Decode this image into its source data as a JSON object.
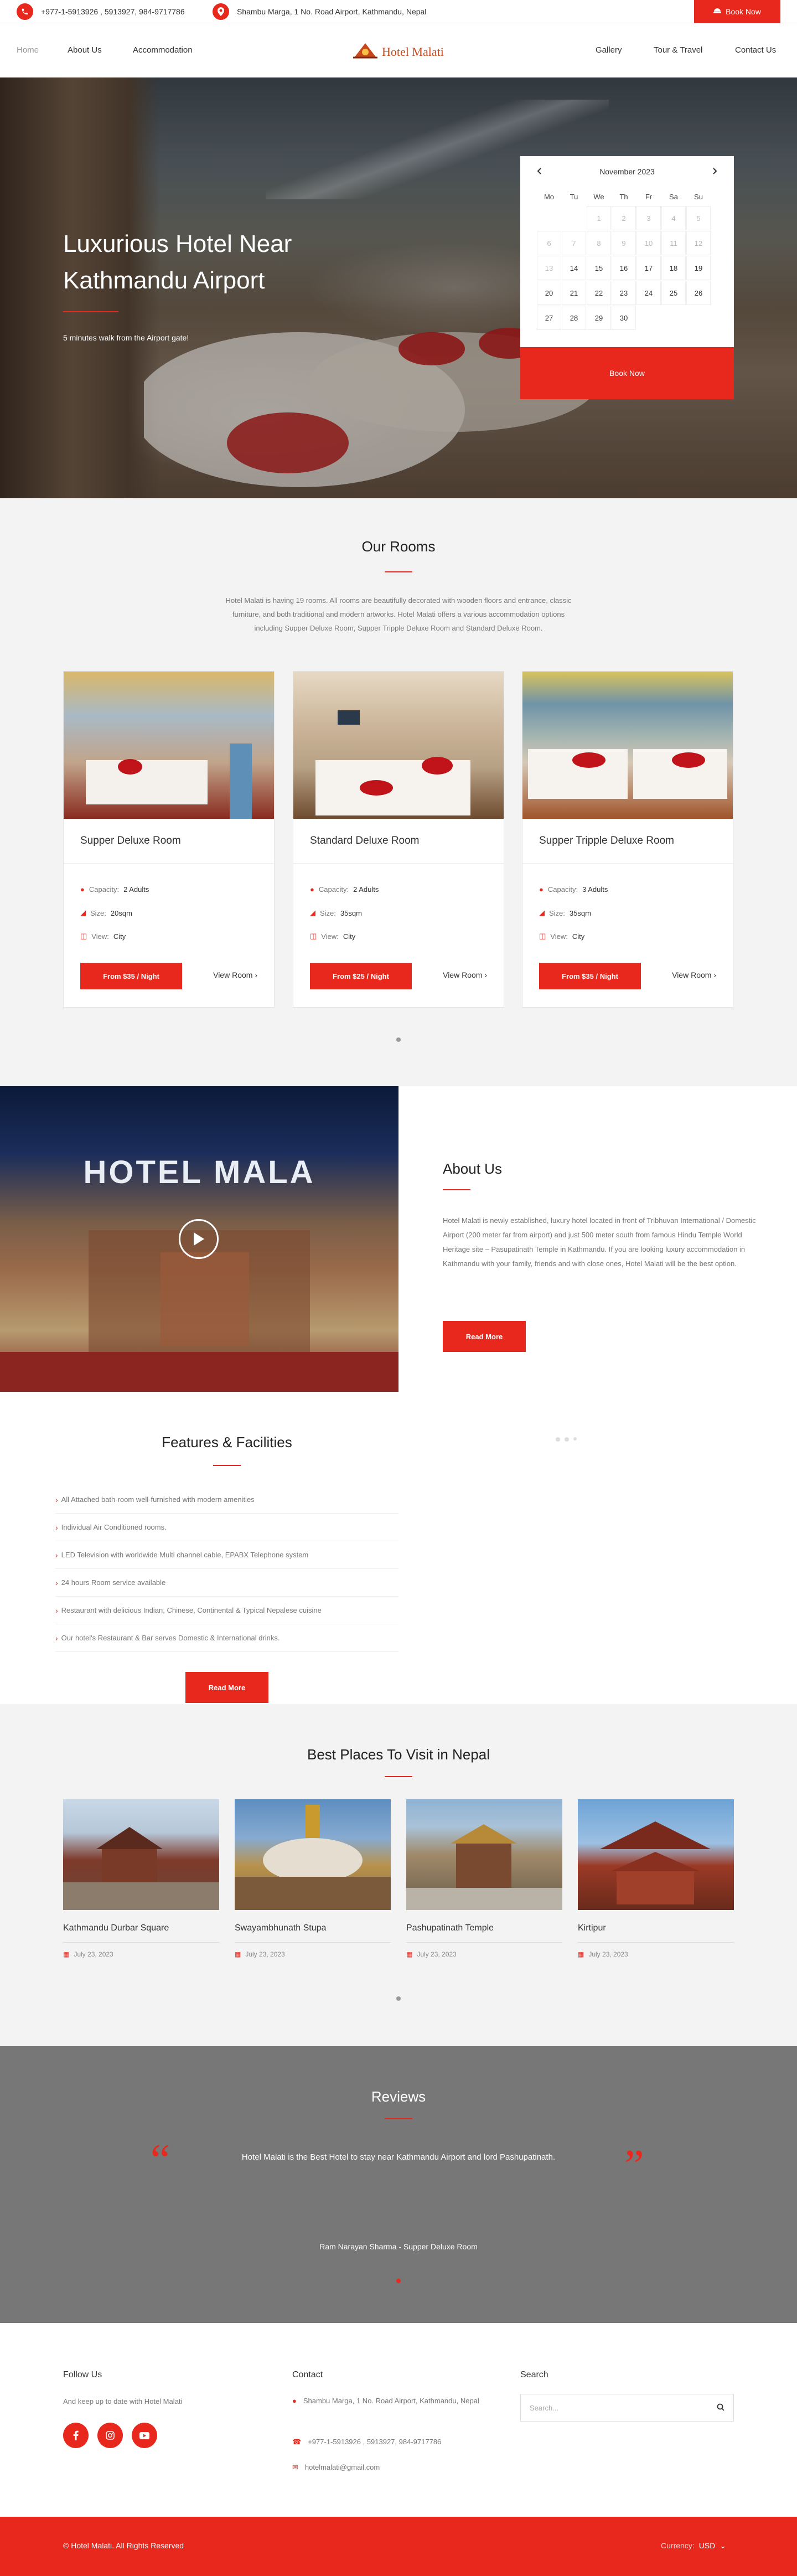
{
  "topbar": {
    "phone": "+977-1-5913926 , 5913927, 984-9717786",
    "address": "Shambu Marga, 1 No. Road Airport, Kathmandu, Nepal",
    "book_now": "Book Now"
  },
  "nav": {
    "left": [
      "Home",
      "About Us",
      "Accommodation"
    ],
    "logo": "Hotel Malati",
    "right": [
      "Gallery",
      "Tour & Travel",
      "Contact Us"
    ]
  },
  "hero": {
    "title": "Luxurious Hotel Near Kathmandu Airport",
    "subtitle": "5 minutes walk from the Airport gate!"
  },
  "calendar": {
    "month": "November 2023",
    "days_of_week": [
      "Mo",
      "Tu",
      "We",
      "Th",
      "Fr",
      "Sa",
      "Su"
    ],
    "book_now": "Book Now"
  },
  "rooms": {
    "title": "Our Rooms",
    "description": "Hotel Malati  is having 19 rooms. All rooms are beautifully decorated with wooden floors and entrance, classic furniture, and both traditional and modern artworks. Hotel Malati offers a various accommodation options including Supper Deluxe Room, Supper Tripple Deluxe Room and Standard Deluxe Room.",
    "capacity_label": "Capacity:",
    "size_label": "Size:",
    "view_label": "View:",
    "view_room": "View Room",
    "items": [
      {
        "name": "Supper Deluxe Room",
        "capacity": "2 Adults",
        "size": "20sqm",
        "view": "City",
        "price": "From $35 / Night"
      },
      {
        "name": "Standard Deluxe Room",
        "capacity": "2 Adults",
        "size": "35sqm",
        "view": "City",
        "price": "From $25 / Night"
      },
      {
        "name": "Supper Tripple Deluxe Room",
        "capacity": "3 Adults",
        "size": "35sqm",
        "view": "City",
        "price": "From $35 / Night"
      }
    ]
  },
  "about": {
    "sign": "HOTEL MALA",
    "title": "About Us",
    "text": "Hotel Malati is newly established, luxury hotel located in front of Tribhuvan International / Domestic Airport (200 meter far from airport) and just 500 meter south from famous Hindu Temple World Heritage site – Pasupatinath Temple in Kathmandu. If you are looking luxury accommodation in Kathmandu with your family, friends and with close ones, Hotel Malati will be the best option.",
    "button": "Read More"
  },
  "features": {
    "title": "Features & Facilities",
    "items": [
      "All Attached bath-room well-furnished with modern amenities",
      "Individual Air Conditioned rooms.",
      "LED Television with worldwide Multi channel cable, EPABX Telephone system",
      "24 hours Room service available",
      "Restaurant with delicious Indian, Chinese, Continental & Typical Nepalese cuisine",
      "Our hotel's Restaurant & Bar serves Domestic & International drinks."
    ],
    "button": "Read More"
  },
  "places": {
    "title": "Best Places To Visit in Nepal",
    "items": [
      {
        "name": "Kathmandu Durbar Square",
        "date": "July 23, 2023"
      },
      {
        "name": "Swayambhunath Stupa",
        "date": "July 23, 2023"
      },
      {
        "name": "Pashupatinath Temple",
        "date": "July 23, 2023"
      },
      {
        "name": "Kirtipur",
        "date": "July 23, 2023"
      }
    ]
  },
  "reviews": {
    "title": "Reviews",
    "quote": "Hotel Malati is the Best Hotel to stay near Kathmandu Airport and lord Pashupatinath.",
    "author": "Ram Narayan Sharma - Supper Deluxe Room"
  },
  "footer": {
    "follow_title": "Follow Us",
    "follow_text": "And keep up to date with Hotel Malati",
    "contact_title": "Contact",
    "address": "Shambu Marga, 1 No. Road Airport, Kathmandu, Nepal",
    "phone": "+977-1-5913926 , 5913927, 984-9717786",
    "email": "hotelmalati@gmail.com",
    "search_title": "Search",
    "search_placeholder": "Search...",
    "copyright": "© Hotel Malati. All Rights Reserved",
    "currency_label": "Currency:",
    "currency_value": "USD"
  },
  "colors": {
    "accent": "#e8271d",
    "review_bg": "#777777",
    "section_bg": "#f3f3f3"
  }
}
